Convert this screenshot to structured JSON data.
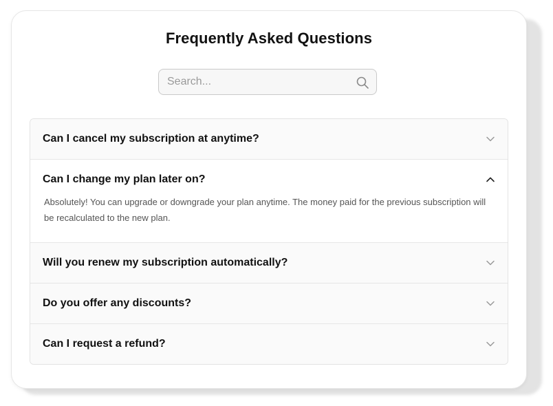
{
  "faq": {
    "title": "Frequently Asked Questions",
    "search": {
      "placeholder": "Search...",
      "value": "",
      "icon": "search-icon"
    },
    "items": [
      {
        "question": "Can I cancel my subscription at anytime?",
        "expanded": false,
        "icon": "chevron-down-icon"
      },
      {
        "question": "Can I change my plan later on?",
        "answer": "Absolutely! You can upgrade or downgrade your plan anytime. The money paid for the previous subscription will be recalculated to the new plan.",
        "expanded": true,
        "icon": "chevron-up-icon"
      },
      {
        "question": "Will you renew my subscription automatically?",
        "expanded": false,
        "icon": "chevron-down-icon"
      },
      {
        "question": "Do you offer any discounts?",
        "expanded": false,
        "icon": "chevron-down-icon"
      },
      {
        "question": "Can I request a refund?",
        "expanded": false,
        "icon": "chevron-down-icon"
      }
    ]
  },
  "colors": {
    "text_primary": "#111111",
    "text_secondary": "#555555",
    "border": "#e3e3e3",
    "collapsed_bg": "#fafafa",
    "chevron_collapsed": "#9a9a9a",
    "chevron_expanded": "#222222"
  }
}
